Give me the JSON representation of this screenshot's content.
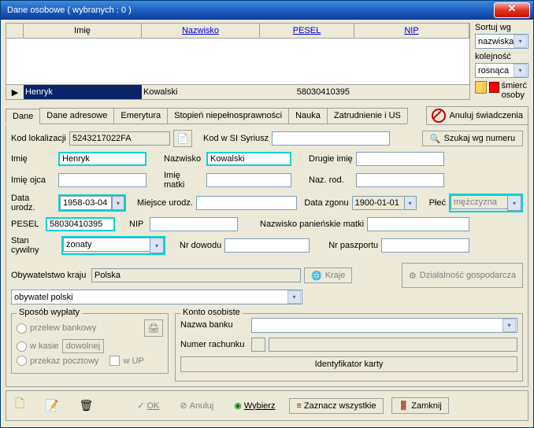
{
  "titlebar": "Dane osobowe ( wybranych : 0 )",
  "grid": {
    "headers": {
      "imie": "Imię",
      "nazwisko": "Nazwisko",
      "pesel": "PESEL",
      "nip": "NIP"
    },
    "row": {
      "imie": "Henryk",
      "nazwisko": "Kowalski",
      "pesel": "58030410395",
      "nip": ""
    }
  },
  "sort": {
    "label_by": "Sortuj wg",
    "by": "nazwiska",
    "label_dir": "kolejność",
    "dir": "rosnąca",
    "death": "śmierć osoby"
  },
  "tabs": {
    "dane": "Dane",
    "adres": "Dane adresowe",
    "emeryt": "Emerytura",
    "stopien": "Stopień niepełnosprawności",
    "nauka": "Nauka",
    "zatr": "Zatrudnienie i US"
  },
  "anuluj_sw": "Anuluj świadczenia",
  "form": {
    "kod_lok_lbl": "Kod lokalizacji",
    "kod_lok": "5243217022FA",
    "kod_si_lbl": "Kod w SI Syriusz",
    "kod_si": "",
    "szukaj_btn": "Szukaj wg numeru",
    "imie_lbl": "Imię",
    "imie": "Henryk",
    "nazwisko_lbl": "Nazwisko",
    "nazwisko": "Kowalski",
    "drugie_lbl": "Drugie imię",
    "drugie": "",
    "imie_ojca_lbl": "Imię ojca",
    "imie_ojca": "",
    "imie_matki_lbl": "Imię matki",
    "imie_matki": "",
    "naz_rod_lbl": "Naz. rod.",
    "naz_rod": "",
    "data_ur_lbl": "Data urodz.",
    "data_ur": "1958-03-04",
    "miejsce_ur_lbl": "Miejsce urodz.",
    "miejsce_ur": "",
    "data_zg_lbl": "Data zgonu",
    "data_zg": "1900-01-01",
    "plec_lbl": "Płeć",
    "plec": "mężczyzna",
    "pesel_lbl": "PESEL",
    "pesel": "58030410395",
    "nip_lbl": "NIP",
    "nip": "",
    "naz_pan_lbl": "Nazwisko panieńskie matki",
    "naz_pan": "",
    "stan_cyw_lbl": "Stan cywilny",
    "stan_cyw": "żonaty",
    "nr_dow_lbl": "Nr dowodu",
    "nr_dow": "",
    "nr_pasz_lbl": "Nr paszportu",
    "nr_pasz": "",
    "obyw_lbl": "Obywatelstwo kraju",
    "obyw": "Polska",
    "kraje_btn": "Kraje",
    "dzial_btn": "Działalność gospodarcza",
    "obyw_typ": "obywatel polski"
  },
  "wyplata": {
    "legend": "Sposób wypłaty",
    "przelew": "przelew bankowy",
    "kasie": "w kasie",
    "dowolnej": "dowolnej",
    "przekaz": "przekaz pocztowy",
    "wup": "w UP"
  },
  "konto": {
    "legend": "Konto osobiste",
    "bank_lbl": "Nazwa banku",
    "bank": "",
    "numer_lbl": "Numer rachunku",
    "ident_btn": "Identyfikator karty"
  },
  "bottom": {
    "ok": "OK",
    "anuluj": "Anuluj",
    "wybierz": "Wybierz",
    "zaznacz": "Zaznacz wszystkie",
    "zamknij": "Zamknij"
  }
}
